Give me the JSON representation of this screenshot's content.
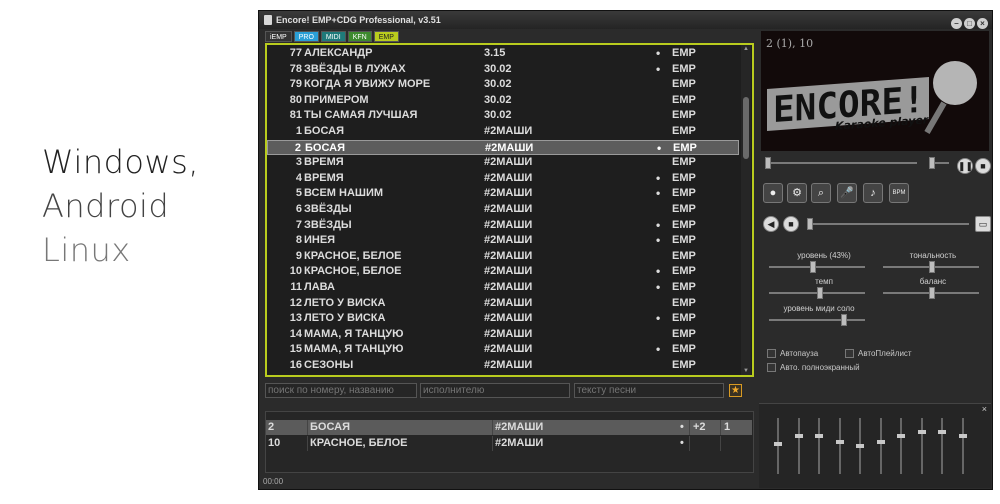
{
  "promo": {
    "line1": "Windows,",
    "line2": "Android",
    "line3": "Linux"
  },
  "window": {
    "title": "Encore! EMP+CDG Professional, v3.51"
  },
  "tabs": [
    {
      "label": "iEMP",
      "color": "#333333"
    },
    {
      "label": "PRO",
      "color": "#2a9fd6"
    },
    {
      "label": "MIDI",
      "color": "#1f7a7a"
    },
    {
      "label": "KFN",
      "color": "#3d8a2e"
    },
    {
      "label": "EMP",
      "color": "#b9cc1e"
    }
  ],
  "songs": [
    {
      "num": "77",
      "title": "АЛЕКСАНДР",
      "artist": "3.15",
      "dot": "•",
      "type": "EMP"
    },
    {
      "num": "78",
      "title": "ЗВЁЗДЫ В ЛУЖАХ",
      "artist": "30.02",
      "dot": "•",
      "type": "EMP"
    },
    {
      "num": "79",
      "title": "КОГДА Я УВИЖУ МОРЕ",
      "artist": "30.02",
      "dot": "",
      "type": "EMP"
    },
    {
      "num": "80",
      "title": "ПРИМЕРОМ",
      "artist": "30.02",
      "dot": "",
      "type": "EMP"
    },
    {
      "num": "81",
      "title": "ТЫ САМАЯ ЛУЧШАЯ",
      "artist": "30.02",
      "dot": "",
      "type": "EMP"
    },
    {
      "num": "1",
      "title": "БОСАЯ",
      "artist": "#2МАШИ",
      "dot": "",
      "type": "EMP"
    },
    {
      "num": "2",
      "title": "БОСАЯ",
      "artist": "#2МАШИ",
      "dot": "•",
      "type": "EMP",
      "selected": true
    },
    {
      "num": "3",
      "title": "ВРЕМЯ",
      "artist": "#2МАШИ",
      "dot": "",
      "type": "EMP"
    },
    {
      "num": "4",
      "title": "ВРЕМЯ",
      "artist": "#2МАШИ",
      "dot": "•",
      "type": "EMP"
    },
    {
      "num": "5",
      "title": "ВСЕМ НАШИМ",
      "artist": "#2МАШИ",
      "dot": "•",
      "type": "EMP"
    },
    {
      "num": "6",
      "title": "ЗВЁЗДЫ",
      "artist": "#2МАШИ",
      "dot": "",
      "type": "EMP"
    },
    {
      "num": "7",
      "title": "ЗВЁЗДЫ",
      "artist": "#2МАШИ",
      "dot": "•",
      "type": "EMP"
    },
    {
      "num": "8",
      "title": "ИНЕЯ",
      "artist": "#2МАШИ",
      "dot": "•",
      "type": "EMP"
    },
    {
      "num": "9",
      "title": "КРАСНОЕ, БЕЛОЕ",
      "artist": "#2МАШИ",
      "dot": "",
      "type": "EMP"
    },
    {
      "num": "10",
      "title": "КРАСНОЕ, БЕЛОЕ",
      "artist": "#2МАШИ",
      "dot": "•",
      "type": "EMP"
    },
    {
      "num": "11",
      "title": "ЛАВА",
      "artist": "#2МАШИ",
      "dot": "•",
      "type": "EMP"
    },
    {
      "num": "12",
      "title": "ЛЕТО У ВИСКА",
      "artist": "#2МАШИ",
      "dot": "",
      "type": "EMP"
    },
    {
      "num": "13",
      "title": "ЛЕТО У ВИСКА",
      "artist": "#2МАШИ",
      "dot": "•",
      "type": "EMP"
    },
    {
      "num": "14",
      "title": "МАМА, Я ТАНЦУЮ",
      "artist": "#2МАШИ",
      "dot": "",
      "type": "EMP"
    },
    {
      "num": "15",
      "title": "МАМА, Я ТАНЦУЮ",
      "artist": "#2МАШИ",
      "dot": "•",
      "type": "EMP"
    },
    {
      "num": "16",
      "title": "СЕЗОНЫ",
      "artist": "#2МАШИ",
      "dot": "",
      "type": "EMP"
    }
  ],
  "search": {
    "by_number_placeholder": "поиск по номеру, названию",
    "by_artist_placeholder": "исполнителю",
    "by_lyrics_placeholder": "тексту песни"
  },
  "queue": [
    {
      "num": "2",
      "title": "БОСАЯ",
      "artist": "#2МАШИ",
      "dot": "•",
      "key": "+2",
      "channel": "1",
      "selected": true
    },
    {
      "num": "10",
      "title": "КРАСНОЕ, БЕЛОЕ",
      "artist": "#2МАШИ",
      "dot": "•",
      "key": "",
      "channel": ""
    }
  ],
  "status": {
    "time": "00:00"
  },
  "player": {
    "screen_info": "2 (1), 10",
    "logo_text": "ENCORE!",
    "logo_sub": "Karaoke player"
  },
  "controls": {
    "level_label": "уровень (43%)",
    "level_value": 43,
    "key_label": "тональность",
    "tempo_label": "темп",
    "balance_label": "баланс",
    "midi_solo_label": "уровень миди соло"
  },
  "options": {
    "autopause": "Автопауза",
    "autoplaylist": "АвтоПлейлист",
    "autofullscreen": "Авто. полноэкранный"
  },
  "colors": {
    "accent": "#b9cc1e",
    "selected_row": "#5d5d5d",
    "star": "#f2a92a"
  },
  "icons": [
    "record-icon",
    "gear-icon",
    "search-icon",
    "microphone-icon",
    "speaker-icon",
    "bpm-icon"
  ]
}
